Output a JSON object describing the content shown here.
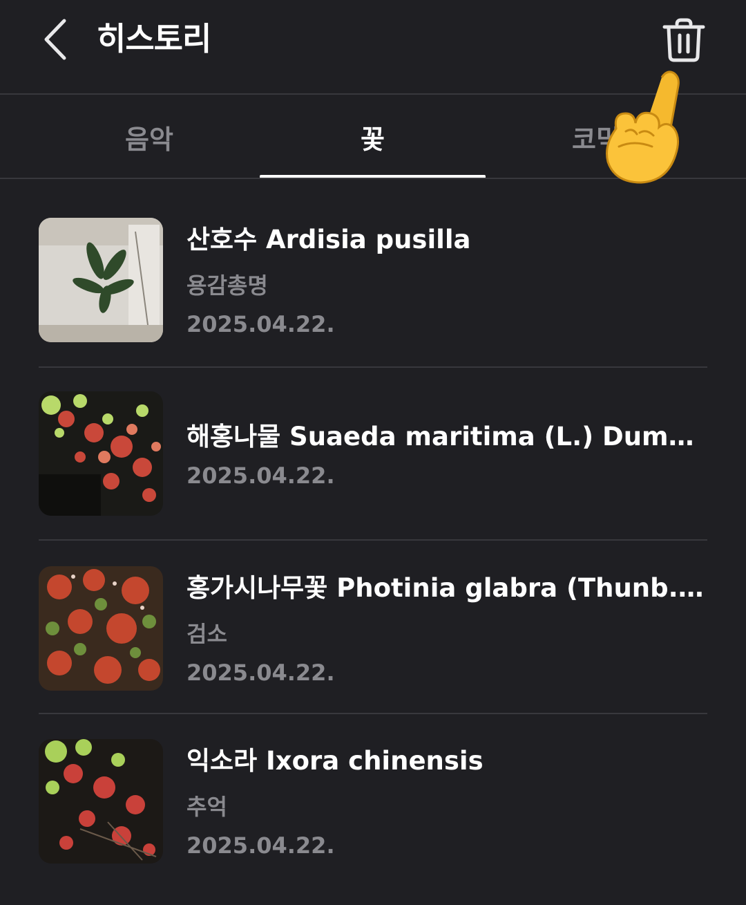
{
  "header": {
    "title": "히스토리"
  },
  "tabs": [
    {
      "label": "음악",
      "active": false
    },
    {
      "label": "꽃",
      "active": true
    },
    {
      "label": "코믹",
      "active": false
    }
  ],
  "items": [
    {
      "name": "산호수 Ardisia pusilla",
      "subtitle": "용감총명",
      "date": "2025.04.22."
    },
    {
      "name": "해홍나물 Suaeda maritima (L.) Dumort.",
      "subtitle": "",
      "date": "2025.04.22."
    },
    {
      "name": "홍가시나무꽃 Photinia glabra (Thunb.) Maxim.",
      "subtitle": "검소",
      "date": "2025.04.22."
    },
    {
      "name": "익소라 Ixora chinensis",
      "subtitle": "추억",
      "date": "2025.04.22."
    }
  ],
  "icons": {
    "back": "chevron-left-icon",
    "delete": "trash-icon",
    "pointer": "pointing-hand-icon"
  },
  "colors": {
    "background": "#1f1f23",
    "divider": "#38383d",
    "text_primary": "#ffffff",
    "text_secondary": "#8a8a8f"
  }
}
